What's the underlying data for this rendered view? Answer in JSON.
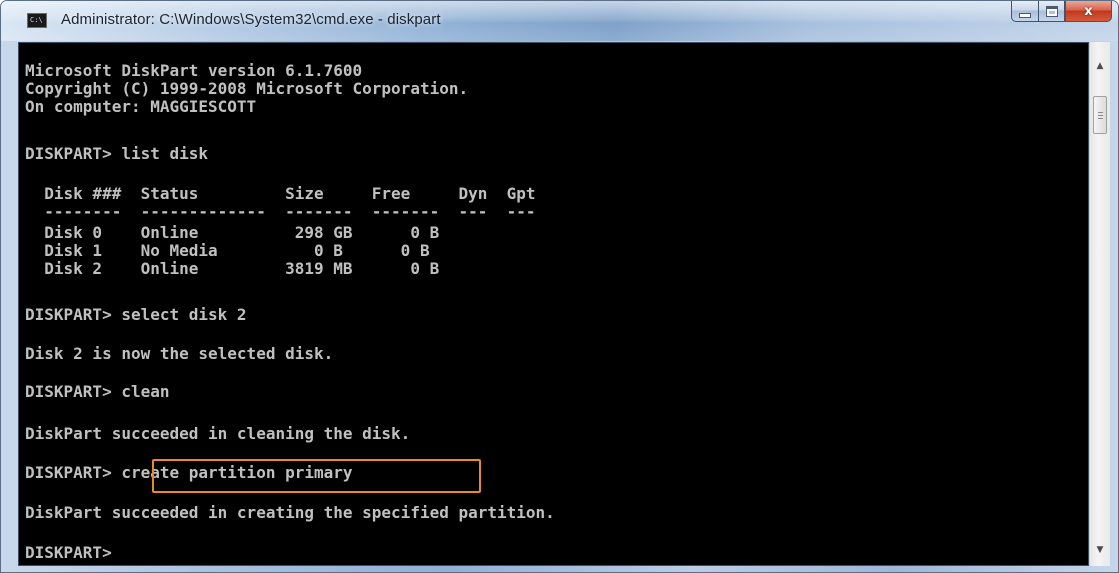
{
  "window": {
    "title": "Administrator: C:\\Windows\\System32\\cmd.exe - diskpart",
    "sys_icon_text": "C:\\",
    "buttons": {
      "minimize": "minimize",
      "maximize": "maximize",
      "close": "x"
    }
  },
  "console": {
    "lines": [
      "Microsoft DiskPart version 6.1.7600",
      "Copyright (C) 1999-2008 Microsoft Corporation.",
      "On computer: MAGGIESCOTT",
      "DISKPART> list disk",
      "  Disk ###  Status         Size     Free     Dyn  Gpt",
      "  --------  -------------  -------  -------  ---  ---",
      "  Disk 0    Online          298 GB      0 B",
      "  Disk 1    No Media          0 B      0 B",
      "  Disk 2    Online         3819 MB      0 B",
      "DISKPART> select disk 2",
      "Disk 2 is now the selected disk.",
      "DISKPART> clean",
      "DiskPart succeeded in cleaning the disk.",
      "DISKPART> create partition primary",
      "DiskPart succeeded in creating the specified partition.",
      "DISKPART>"
    ],
    "highlighted_command": "create partition primary"
  },
  "colors": {
    "console_bg": "#000000",
    "console_text": "#c0c0c0",
    "highlight": "#e8892a"
  },
  "icons": {
    "system": "cmd-icon",
    "minimize": "minimize-icon",
    "maximize": "maximize-icon",
    "close": "close-icon",
    "scroll_up": "scroll-up-icon",
    "scroll_down": "scroll-down-icon"
  }
}
